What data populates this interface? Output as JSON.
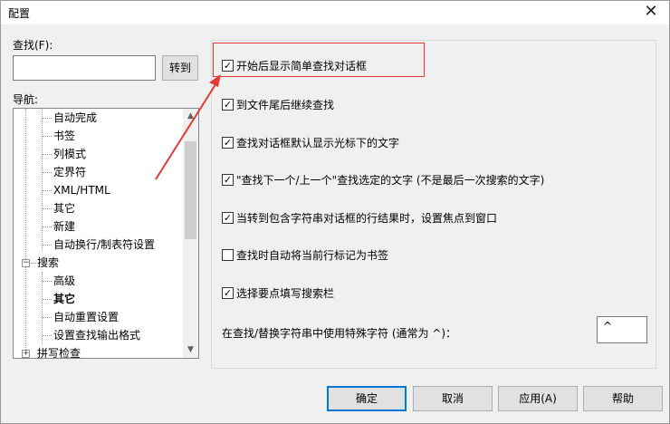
{
  "window": {
    "title": "配置",
    "close_glyph": "✕"
  },
  "find": {
    "label": "查找(F):",
    "value": "",
    "goto_label": "转到"
  },
  "nav": {
    "label": "导航:",
    "items": [
      {
        "label": "自动完成",
        "bold": false
      },
      {
        "label": "书签",
        "bold": false
      },
      {
        "label": "列模式",
        "bold": false
      },
      {
        "label": "定界符",
        "bold": false
      },
      {
        "label": "XML/HTML",
        "bold": false
      },
      {
        "label": "其它",
        "bold": false
      },
      {
        "label": "新建",
        "bold": false
      },
      {
        "label": "自动换行/制表符设置",
        "bold": false
      },
      {
        "label": "搜索",
        "bold": false
      },
      {
        "label": "高级",
        "bold": false
      },
      {
        "label": "其它",
        "bold": true
      },
      {
        "label": "自动重置设置",
        "bold": false
      },
      {
        "label": "设置查找输出格式",
        "bold": false
      },
      {
        "label": "拼写检查",
        "bold": false
      }
    ]
  },
  "options": [
    {
      "label": "开始后显示简单查找对话框",
      "checked": true
    },
    {
      "label": "到文件尾后继续查找",
      "checked": true
    },
    {
      "label": "查找对话框默认显示光标下的文字",
      "checked": true
    },
    {
      "label": "\"查找下一个/上一个\"查找选定的文字 (不是最后一次搜索的文字)",
      "checked": true
    },
    {
      "label": "当转到包含字符串对话框的行结果时，设置焦点到窗口",
      "checked": true
    },
    {
      "label": "查找时自动将当前行标记为书签",
      "checked": false
    },
    {
      "label": "选择要点填写搜索栏",
      "checked": true
    }
  ],
  "special_char": {
    "label": "在查找/替换字符串中使用特殊字符 (通常为 ^)：",
    "value": "^"
  },
  "buttons": {
    "ok": "确定",
    "cancel": "取消",
    "apply": "应用(A)",
    "help": "帮助"
  },
  "colors": {
    "annotation": "#e53935",
    "focus": "#0078d7"
  }
}
